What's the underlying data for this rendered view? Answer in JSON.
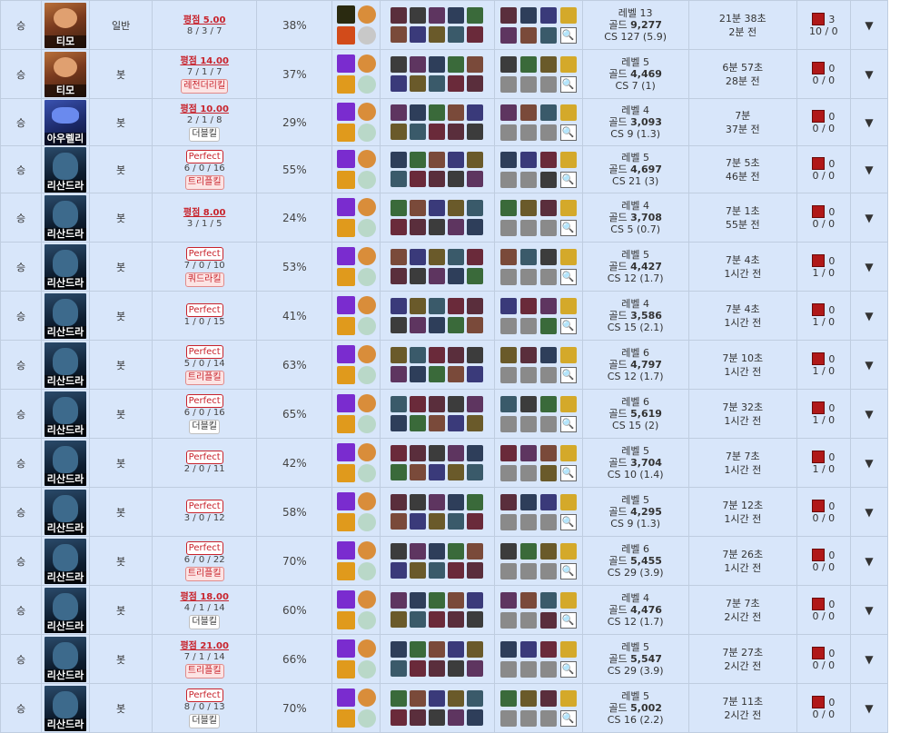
{
  "rows": [
    {
      "result": "승",
      "champion": "티모",
      "portrait": "teemo",
      "mode": "일반",
      "grade": "평점 5.00",
      "kda": "8 / 3 / 7",
      "perfect": false,
      "multikill": "",
      "multikill_style": "",
      "ratio": "38%",
      "level": "레벨 13",
      "gold_label": "골드",
      "gold": "9,277",
      "cs": "CS 127 (5.9)",
      "duration": "21분 38초",
      "ago": "2분 전",
      "wards_primary": "3",
      "wards_secondary": "10 / 0"
    },
    {
      "result": "승",
      "champion": "티모",
      "portrait": "teemo",
      "mode": "봇",
      "grade": "평점 14.00",
      "kda": "7 / 1 / 7",
      "perfect": false,
      "multikill": "레전더리킬",
      "multikill_style": "red",
      "ratio": "37%",
      "level": "레벨 5",
      "gold_label": "골드",
      "gold": "4,469",
      "cs": "CS 7 (1)",
      "duration": "6분 57초",
      "ago": "28분 전",
      "wards_primary": "0",
      "wards_secondary": "0 / 0"
    },
    {
      "result": "승",
      "champion": "아우렐리",
      "portrait": "rumble",
      "mode": "봇",
      "grade": "평점 10.00",
      "kda": "2 / 1 / 8",
      "perfect": false,
      "multikill": "더블킬",
      "multikill_style": "plain",
      "ratio": "29%",
      "level": "레벨 4",
      "gold_label": "골드",
      "gold": "3,093",
      "cs": "CS 9 (1.3)",
      "duration": "7분",
      "ago": "37분 전",
      "wards_primary": "0",
      "wards_secondary": "0 / 0"
    },
    {
      "result": "승",
      "champion": "리산드라",
      "portrait": "lissandra",
      "mode": "봇",
      "grade": "Perfect",
      "kda": "6 / 0 / 16",
      "perfect": true,
      "multikill": "트리플킬",
      "multikill_style": "red",
      "ratio": "55%",
      "level": "레벨 5",
      "gold_label": "골드",
      "gold": "4,697",
      "cs": "CS 21 (3)",
      "duration": "7분 5초",
      "ago": "46분 전",
      "wards_primary": "0",
      "wards_secondary": "0 / 0"
    },
    {
      "result": "승",
      "champion": "리산드라",
      "portrait": "lissandra",
      "mode": "봇",
      "grade": "평점 8.00",
      "kda": "3 / 1 / 5",
      "perfect": false,
      "multikill": "",
      "multikill_style": "",
      "ratio": "24%",
      "level": "레벨 4",
      "gold_label": "골드",
      "gold": "3,708",
      "cs": "CS 5 (0.7)",
      "duration": "7분 1초",
      "ago": "55분 전",
      "wards_primary": "0",
      "wards_secondary": "0 / 0"
    },
    {
      "result": "승",
      "champion": "리산드라",
      "portrait": "lissandra",
      "mode": "봇",
      "grade": "Perfect",
      "kda": "7 / 0 / 10",
      "perfect": true,
      "multikill": "쿼드라킬",
      "multikill_style": "red",
      "ratio": "53%",
      "level": "레벨 5",
      "gold_label": "골드",
      "gold": "4,427",
      "cs": "CS 12 (1.7)",
      "duration": "7분 4초",
      "ago": "1시간 전",
      "wards_primary": "0",
      "wards_secondary": "1 / 0"
    },
    {
      "result": "승",
      "champion": "리산드라",
      "portrait": "lissandra",
      "mode": "봇",
      "grade": "Perfect",
      "kda": "1 / 0 / 15",
      "perfect": true,
      "multikill": "",
      "multikill_style": "",
      "ratio": "41%",
      "level": "레벨 4",
      "gold_label": "골드",
      "gold": "3,586",
      "cs": "CS 15 (2.1)",
      "duration": "7분 4초",
      "ago": "1시간 전",
      "wards_primary": "0",
      "wards_secondary": "1 / 0"
    },
    {
      "result": "승",
      "champion": "리산드라",
      "portrait": "lissandra",
      "mode": "봇",
      "grade": "Perfect",
      "kda": "5 / 0 / 14",
      "perfect": true,
      "multikill": "트리플킬",
      "multikill_style": "red",
      "ratio": "63%",
      "level": "레벨 6",
      "gold_label": "골드",
      "gold": "4,797",
      "cs": "CS 12 (1.7)",
      "duration": "7분 10초",
      "ago": "1시간 전",
      "wards_primary": "0",
      "wards_secondary": "1 / 0"
    },
    {
      "result": "승",
      "champion": "리산드라",
      "portrait": "lissandra",
      "mode": "봇",
      "grade": "Perfect",
      "kda": "6 / 0 / 16",
      "perfect": true,
      "multikill": "더블킬",
      "multikill_style": "plain",
      "ratio": "65%",
      "level": "레벨 6",
      "gold_label": "골드",
      "gold": "5,619",
      "cs": "CS 15 (2)",
      "duration": "7분 32초",
      "ago": "1시간 전",
      "wards_primary": "0",
      "wards_secondary": "1 / 0"
    },
    {
      "result": "승",
      "champion": "리산드라",
      "portrait": "lissandra",
      "mode": "봇",
      "grade": "Perfect",
      "kda": "2 / 0 / 11",
      "perfect": true,
      "multikill": "",
      "multikill_style": "",
      "ratio": "42%",
      "level": "레벨 5",
      "gold_label": "골드",
      "gold": "3,704",
      "cs": "CS 10 (1.4)",
      "duration": "7분 7초",
      "ago": "1시간 전",
      "wards_primary": "0",
      "wards_secondary": "1 / 0"
    },
    {
      "result": "승",
      "champion": "리산드라",
      "portrait": "lissandra",
      "mode": "봇",
      "grade": "Perfect",
      "kda": "3 / 0 / 12",
      "perfect": true,
      "multikill": "",
      "multikill_style": "",
      "ratio": "58%",
      "level": "레벨 5",
      "gold_label": "골드",
      "gold": "4,295",
      "cs": "CS 9 (1.3)",
      "duration": "7분 12초",
      "ago": "1시간 전",
      "wards_primary": "0",
      "wards_secondary": "0 / 0"
    },
    {
      "result": "승",
      "champion": "리산드라",
      "portrait": "lissandra",
      "mode": "봇",
      "grade": "Perfect",
      "kda": "6 / 0 / 22",
      "perfect": true,
      "multikill": "트리플킬",
      "multikill_style": "red",
      "ratio": "70%",
      "level": "레벨 6",
      "gold_label": "골드",
      "gold": "5,455",
      "cs": "CS 29 (3.9)",
      "duration": "7분 26초",
      "ago": "1시간 전",
      "wards_primary": "0",
      "wards_secondary": "0 / 0"
    },
    {
      "result": "승",
      "champion": "리산드라",
      "portrait": "lissandra",
      "mode": "봇",
      "grade": "평점 18.00",
      "kda": "4 / 1 / 14",
      "perfect": false,
      "multikill": "더블킬",
      "multikill_style": "plain",
      "ratio": "60%",
      "level": "레벨 4",
      "gold_label": "골드",
      "gold": "4,476",
      "cs": "CS 12 (1.7)",
      "duration": "7분 7초",
      "ago": "2시간 전",
      "wards_primary": "0",
      "wards_secondary": "0 / 0"
    },
    {
      "result": "승",
      "champion": "리산드라",
      "portrait": "lissandra",
      "mode": "봇",
      "grade": "평점 21.00",
      "kda": "7 / 1 / 14",
      "perfect": false,
      "multikill": "트리플킬",
      "multikill_style": "red",
      "ratio": "66%",
      "level": "레벨 5",
      "gold_label": "골드",
      "gold": "5,547",
      "cs": "CS 29 (3.9)",
      "duration": "7분 27초",
      "ago": "2시간 전",
      "wards_primary": "0",
      "wards_secondary": "0 / 0"
    },
    {
      "result": "승",
      "champion": "리산드라",
      "portrait": "lissandra",
      "mode": "봇",
      "grade": "Perfect",
      "kda": "8 / 0 / 13",
      "perfect": true,
      "multikill": "더블킬",
      "multikill_style": "plain",
      "ratio": "70%",
      "level": "레벨 5",
      "gold_label": "골드",
      "gold": "5,002",
      "cs": "CS 16 (2.2)",
      "duration": "7분 11초",
      "ago": "2시간 전",
      "wards_primary": "0",
      "wards_secondary": "0 / 0"
    }
  ],
  "expand_glyph": "▼",
  "magnify_glyph": "🔍",
  "colors": {
    "row_bg": "#d8e6fa",
    "border": "#bfcde0",
    "accent_red": "#c8232c",
    "ward_gold": "#d4a92a",
    "empty_slot": "#8a8a8a"
  },
  "icon_names": {
    "summoner_spell": "summoner-spell-icon",
    "rune": "rune-icon",
    "champion": "champion-icon",
    "item": "item-icon",
    "ward_item": "ward-item-icon",
    "empty_slot": "empty-item-slot",
    "build_detail": "magnify-icon",
    "control_ward": "control-ward-icon"
  }
}
